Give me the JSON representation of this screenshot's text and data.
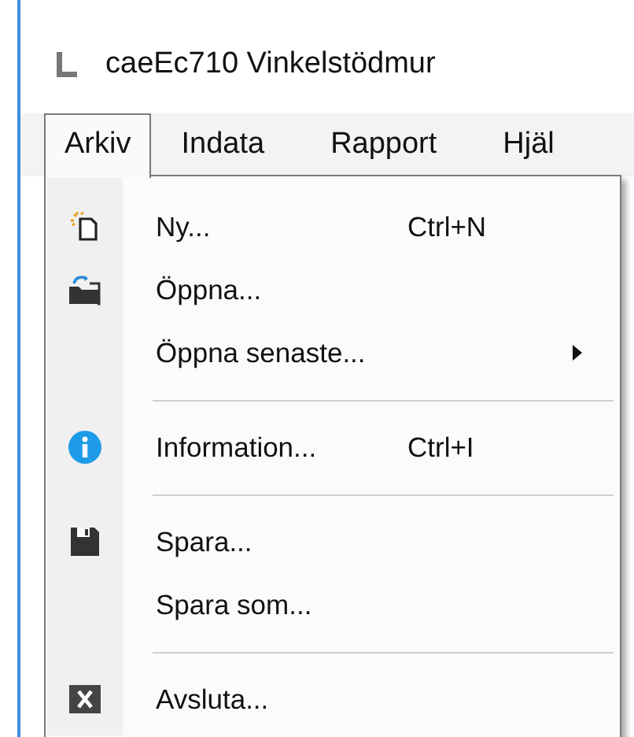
{
  "window": {
    "title": "caeEc710 Vinkelstödmur"
  },
  "menubar": [
    {
      "label": "Arkiv",
      "selected": true
    },
    {
      "label": "Indata",
      "selected": false
    },
    {
      "label": "Rapport",
      "selected": false
    },
    {
      "label": "Hjäl",
      "selected": false
    }
  ],
  "menu": [
    {
      "kind": "item",
      "label": "Ny...",
      "shortcut": "Ctrl+N",
      "submenu": false
    },
    {
      "kind": "item",
      "label": "Öppna...",
      "submenu": false
    },
    {
      "kind": "item",
      "label": "Öppna senaste...",
      "submenu": true
    },
    {
      "kind": "separator"
    },
    {
      "kind": "item",
      "label": "Information...",
      "shortcut": "Ctrl+I",
      "submenu": false
    },
    {
      "kind": "separator"
    },
    {
      "kind": "item",
      "label": "Spara...",
      "submenu": false
    },
    {
      "kind": "item",
      "label": "Spara som...",
      "submenu": false
    },
    {
      "kind": "separator"
    },
    {
      "kind": "item",
      "label": "Avsluta...",
      "submenu": false
    }
  ]
}
